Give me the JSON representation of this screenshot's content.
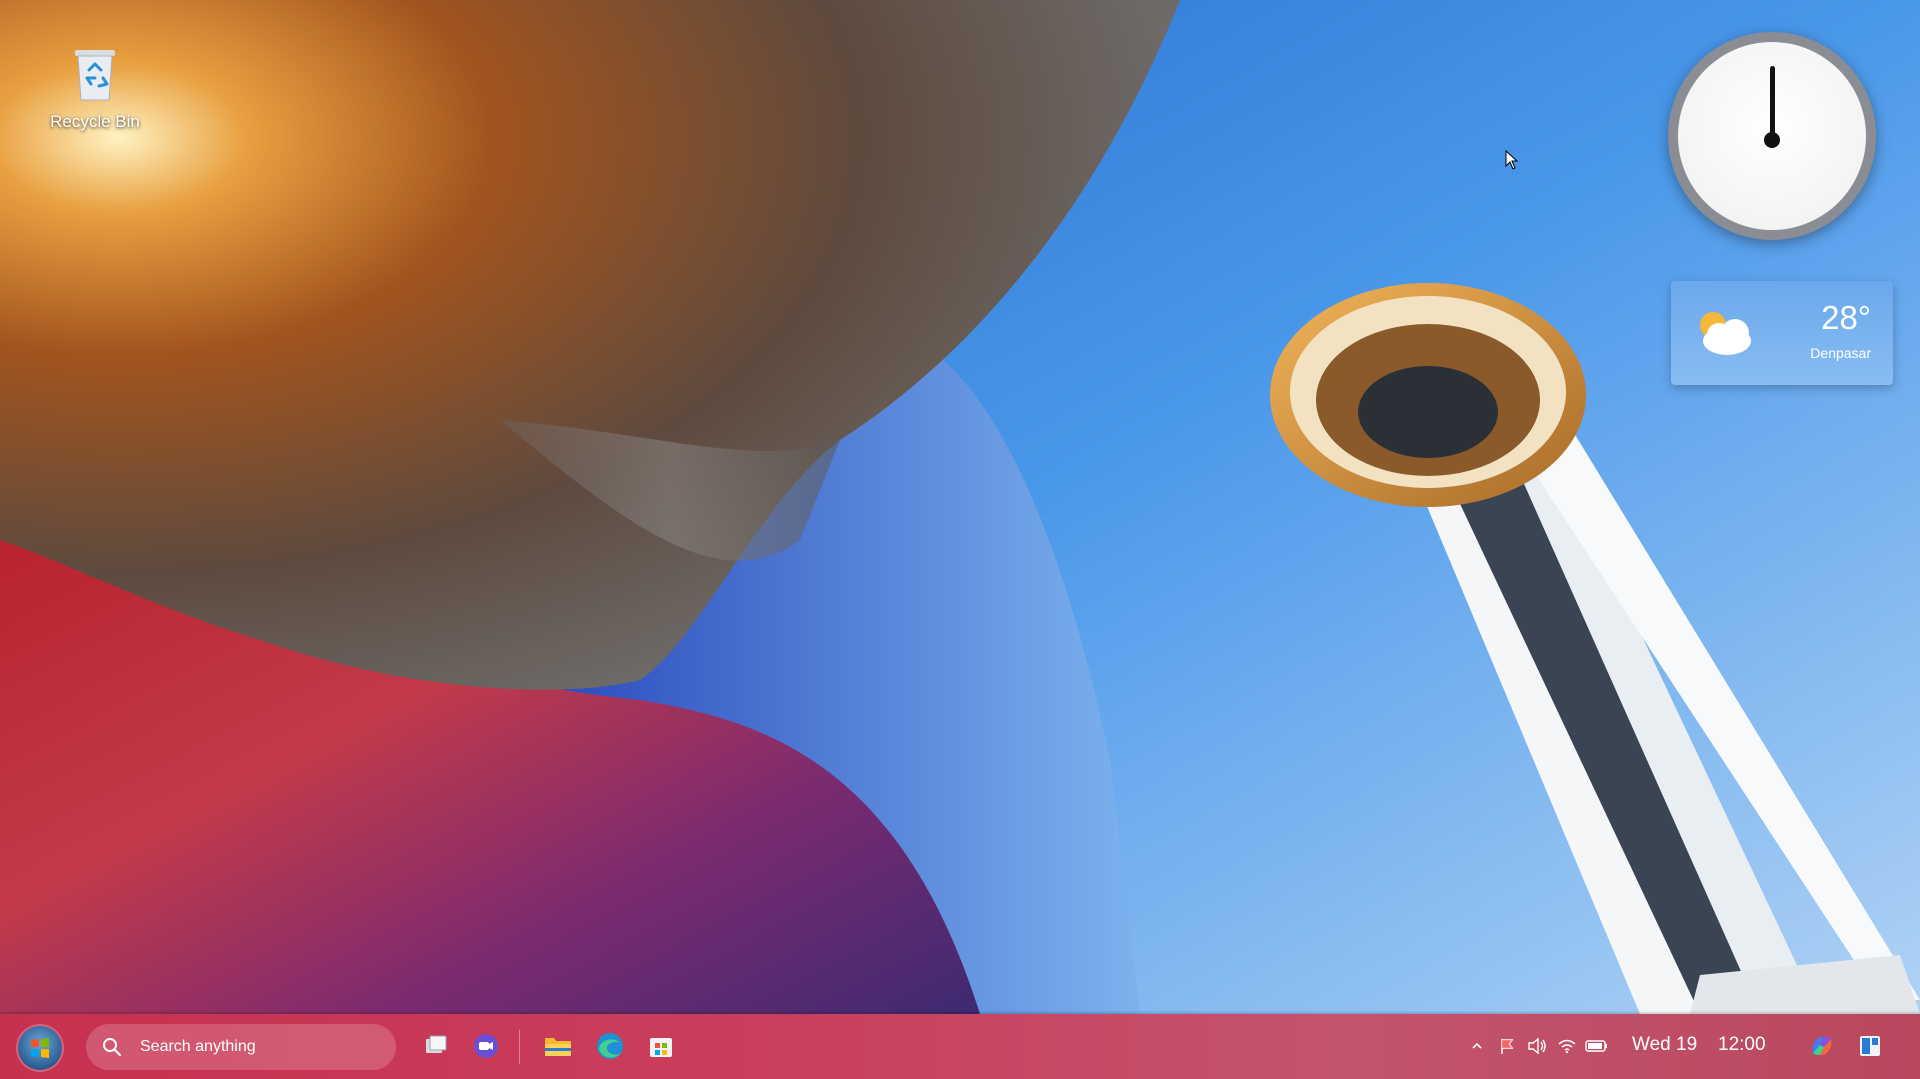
{
  "desktop": {
    "icons": [
      {
        "label": "Recycle Bin",
        "icon": "recycle-bin-icon"
      }
    ]
  },
  "widgets": {
    "clock": {
      "hour": 12,
      "minute": 0
    },
    "weather": {
      "temperature": "28°",
      "city": "Denpasar",
      "condition_icon": "partly-cloudy-icon"
    }
  },
  "taskbar": {
    "start_icon": "start-orb-icon",
    "search": {
      "placeholder": "Search anything"
    },
    "pinned": [
      {
        "name": "task-view",
        "icon": "task-view-icon"
      },
      {
        "name": "meet",
        "icon": "video-call-icon"
      },
      {
        "name": "file-explorer",
        "icon": "folder-icon"
      },
      {
        "name": "edge",
        "icon": "edge-browser-icon"
      },
      {
        "name": "store",
        "icon": "store-icon"
      }
    ],
    "tray": {
      "icons": [
        "chevron-up-icon",
        "flag-icon",
        "volume-icon",
        "wifi-icon",
        "battery-icon"
      ],
      "date": "Wed 19",
      "time": "12:00"
    },
    "right_icons": [
      "copilot-icon",
      "widgets-panel-icon"
    ]
  },
  "colors": {
    "taskbar": "#c93f5d",
    "sky": "#3d8fe6"
  }
}
